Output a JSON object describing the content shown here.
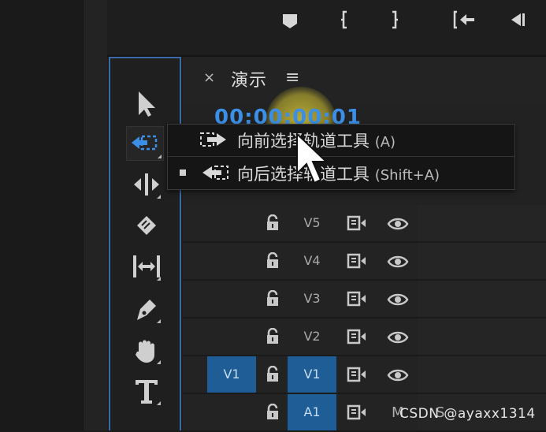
{
  "timeline_tab": {
    "close": "×",
    "title": "演示",
    "menu": "≡"
  },
  "timecode": "00:00:00:01",
  "context_menu": {
    "items": [
      {
        "label": "向前选择轨道工具",
        "shortcut": "(A)",
        "checked": false
      },
      {
        "label": "向后选择轨道工具",
        "shortcut": "(Shift+A)",
        "checked": true
      }
    ]
  },
  "tracks": [
    {
      "label": "V5",
      "source_patch": "",
      "targeted": false
    },
    {
      "label": "V4",
      "source_patch": "",
      "targeted": false
    },
    {
      "label": "V3",
      "source_patch": "",
      "targeted": false
    },
    {
      "label": "V2",
      "source_patch": "",
      "targeted": false
    },
    {
      "label": "V1",
      "source_patch": "V1",
      "targeted": true
    },
    {
      "label": "A1",
      "source_patch": "",
      "targeted": true
    }
  ],
  "audio_buttons": {
    "mute": "M",
    "solo": "S"
  },
  "watermark": "CSDN @ayaxx1314",
  "colors": {
    "accent": "#3b8fe6",
    "track_target": "#1e5d96",
    "panel_border": "#3a6aa8"
  },
  "tools": [
    "selection-tool",
    "track-select-tool",
    "ripple-edit-tool",
    "razor-tool",
    "slip-tool",
    "pen-tool",
    "hand-tool",
    "type-tool"
  ]
}
